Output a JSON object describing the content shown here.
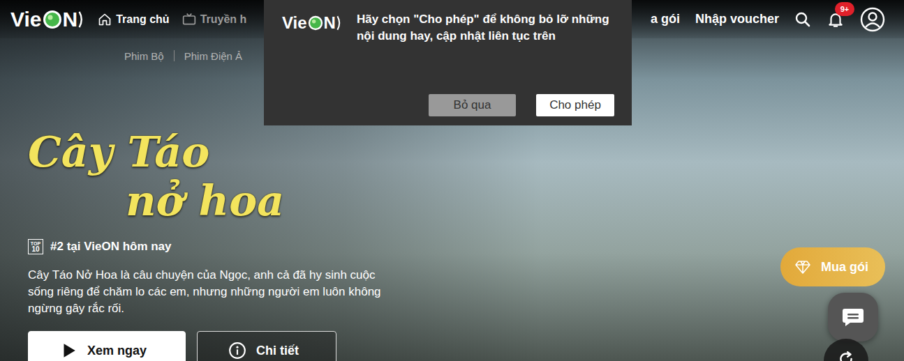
{
  "header": {
    "logo": {
      "prefix": "Vie",
      "suffix": "N"
    },
    "nav": [
      {
        "label": "Trang chủ",
        "selected": true,
        "kind": "home"
      },
      {
        "label": "Truyền h",
        "selected": false,
        "kind": "tv"
      }
    ],
    "actions": [
      "a gói",
      "Nhập voucher"
    ],
    "notifications": {
      "badge": "9+"
    }
  },
  "subnav": [
    "Phim Bộ",
    "Phim Điện Ả"
  ],
  "hero": {
    "title_lines": [
      "Cây Táo",
      "nở hoa"
    ],
    "rank_icon": {
      "top": "TOP",
      "num": "10"
    },
    "rank": "#2 tại VieON hôm nay",
    "description": "Cây Táo Nở Hoa là câu chuyện của Ngọc, anh cả đã hy sinh cuộc sống riêng để chăm lo các em, nhưng những người em luôn không ngừng gây rắc rối.",
    "buttons": [
      {
        "label": "Xem ngay",
        "kind": "primary"
      },
      {
        "label": "Chi tiết",
        "kind": "secondary"
      }
    ]
  },
  "floating": {
    "buy": "Mua gói"
  },
  "popup": {
    "logo": {
      "prefix": "Vie",
      "suffix": "N"
    },
    "message": "Hãy chọn \"Cho phép\" để không bỏ lỡ những nội dung hay, cập nhật liên tục trên",
    "buttons": [
      {
        "label": "Bỏ qua",
        "kind": "dismiss"
      },
      {
        "label": "Cho phép",
        "kind": "allow"
      }
    ]
  }
}
